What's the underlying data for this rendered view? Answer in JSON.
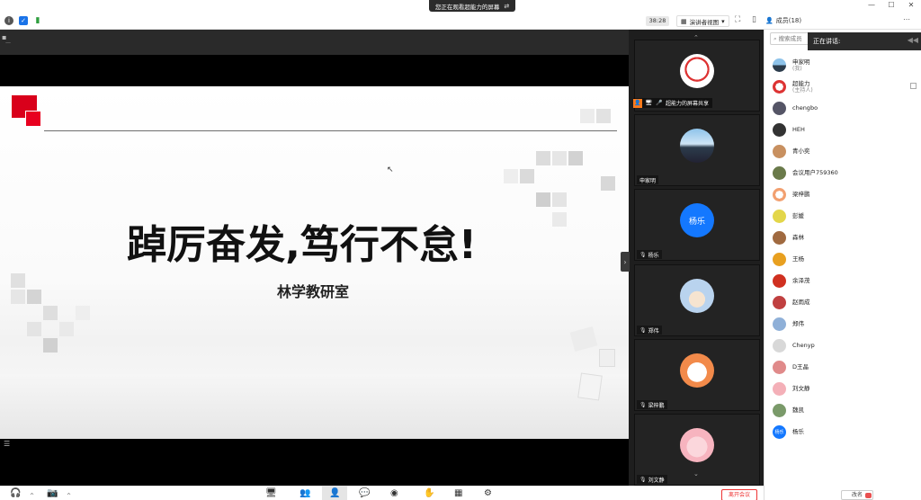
{
  "share_banner": {
    "text": "您正在观看超能力的屏幕",
    "icon": "switch-icon"
  },
  "titlebar": {
    "timer": "38:28",
    "view_label": "演讲者视图",
    "members_label": "成员(18)"
  },
  "slide": {
    "title": "踔厉奋发,笃行不怠!",
    "subtitle": "林学教研室"
  },
  "video_tiles": [
    {
      "name": "超能力的屏幕共享",
      "avatar": "panda-cartoon-avatar"
    },
    {
      "name": "申家明",
      "avatar": "landscape-avatar"
    },
    {
      "name": "杨乐",
      "avatar_text": "杨乐"
    },
    {
      "name": "郑伟",
      "avatar": "castle-cartoon-avatar"
    },
    {
      "name": "梁梓鹏",
      "avatar": "bunny-cartoon-avatar"
    },
    {
      "name": "刘文静",
      "avatar": "pink-cartoon-avatar"
    }
  ],
  "right_panel": {
    "search_placeholder": "搜索成员",
    "speaking_label": "正在讲话:",
    "members": [
      {
        "name": "申家明",
        "role": "(我)",
        "color": "#3c6e8f"
      },
      {
        "name": "超能力",
        "role": "(主持人)",
        "color": "#d0313a"
      },
      {
        "name": "chengbo",
        "role": "",
        "color": "#555566"
      },
      {
        "name": "HEH",
        "role": "",
        "color": "#333333"
      },
      {
        "name": "青小奕",
        "role": "",
        "color": "#c89060"
      },
      {
        "name": "会议用户759360",
        "role": "",
        "color": "#6a7a4a"
      },
      {
        "name": "梁梓鹏",
        "role": "",
        "color": "#f2a070"
      },
      {
        "name": "彭媛",
        "role": "",
        "color": "#e3d64a"
      },
      {
        "name": "森林",
        "role": "",
        "color": "#a06a40"
      },
      {
        "name": "王杨",
        "role": "",
        "color": "#e8a020"
      },
      {
        "name": "余泽茂",
        "role": "",
        "color": "#d03020"
      },
      {
        "name": "赵雨成",
        "role": "",
        "color": "#c04040"
      },
      {
        "name": "郑伟",
        "role": "",
        "color": "#8fb0d8"
      },
      {
        "name": "Chenyp",
        "role": "",
        "color": "#d8d8d8"
      },
      {
        "name": "D王晶",
        "role": "",
        "color": "#e08a8a"
      },
      {
        "name": "刘文静",
        "role": "",
        "color": "#f4b0b8"
      },
      {
        "name": "魏凯",
        "role": "",
        "color": "#7a9a6a"
      },
      {
        "name": "杨乐",
        "role": "",
        "color": "#1478ff",
        "avatar_text": "杨乐"
      }
    ]
  },
  "toolbar": {
    "leave_label": "离开会议",
    "right_button": "改名"
  },
  "colors": {
    "accent_blue": "#1478ff",
    "brand_red": "#d9001b",
    "leave_red": "#e33333"
  }
}
